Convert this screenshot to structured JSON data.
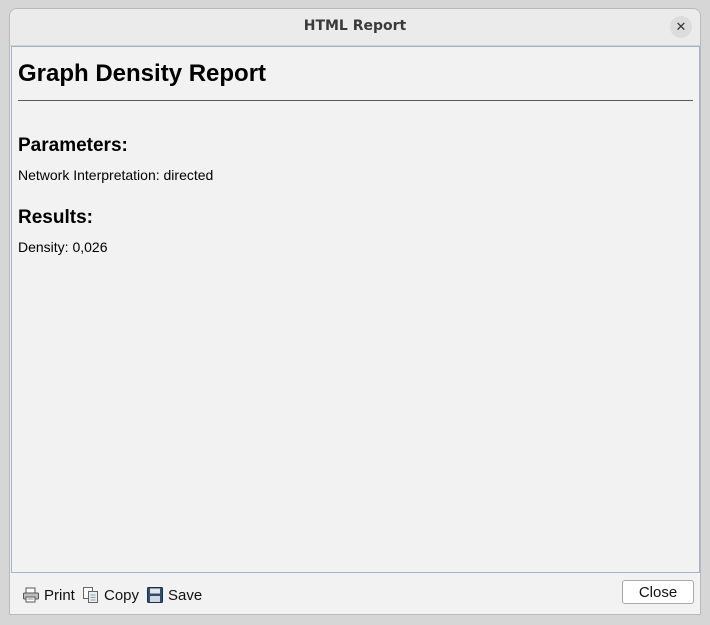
{
  "window": {
    "title": "HTML Report",
    "close_glyph": "✕"
  },
  "report": {
    "heading": "Graph Density Report",
    "parameters_heading": "Parameters:",
    "parameters_line": "Network Interpretation: directed",
    "results_heading": "Results:",
    "results_line": "Density: 0,026"
  },
  "footer": {
    "print_label": "Print",
    "copy_label": "Copy",
    "save_label": "Save",
    "close_label": "Close",
    "icons": [
      "printer-icon",
      "copy-icon",
      "floppy-disk-icon"
    ]
  },
  "colors": {
    "window_bg": "#f2f2f2",
    "titlebar_bg": "#ebebeb",
    "content_border": "#9fb4cc"
  }
}
